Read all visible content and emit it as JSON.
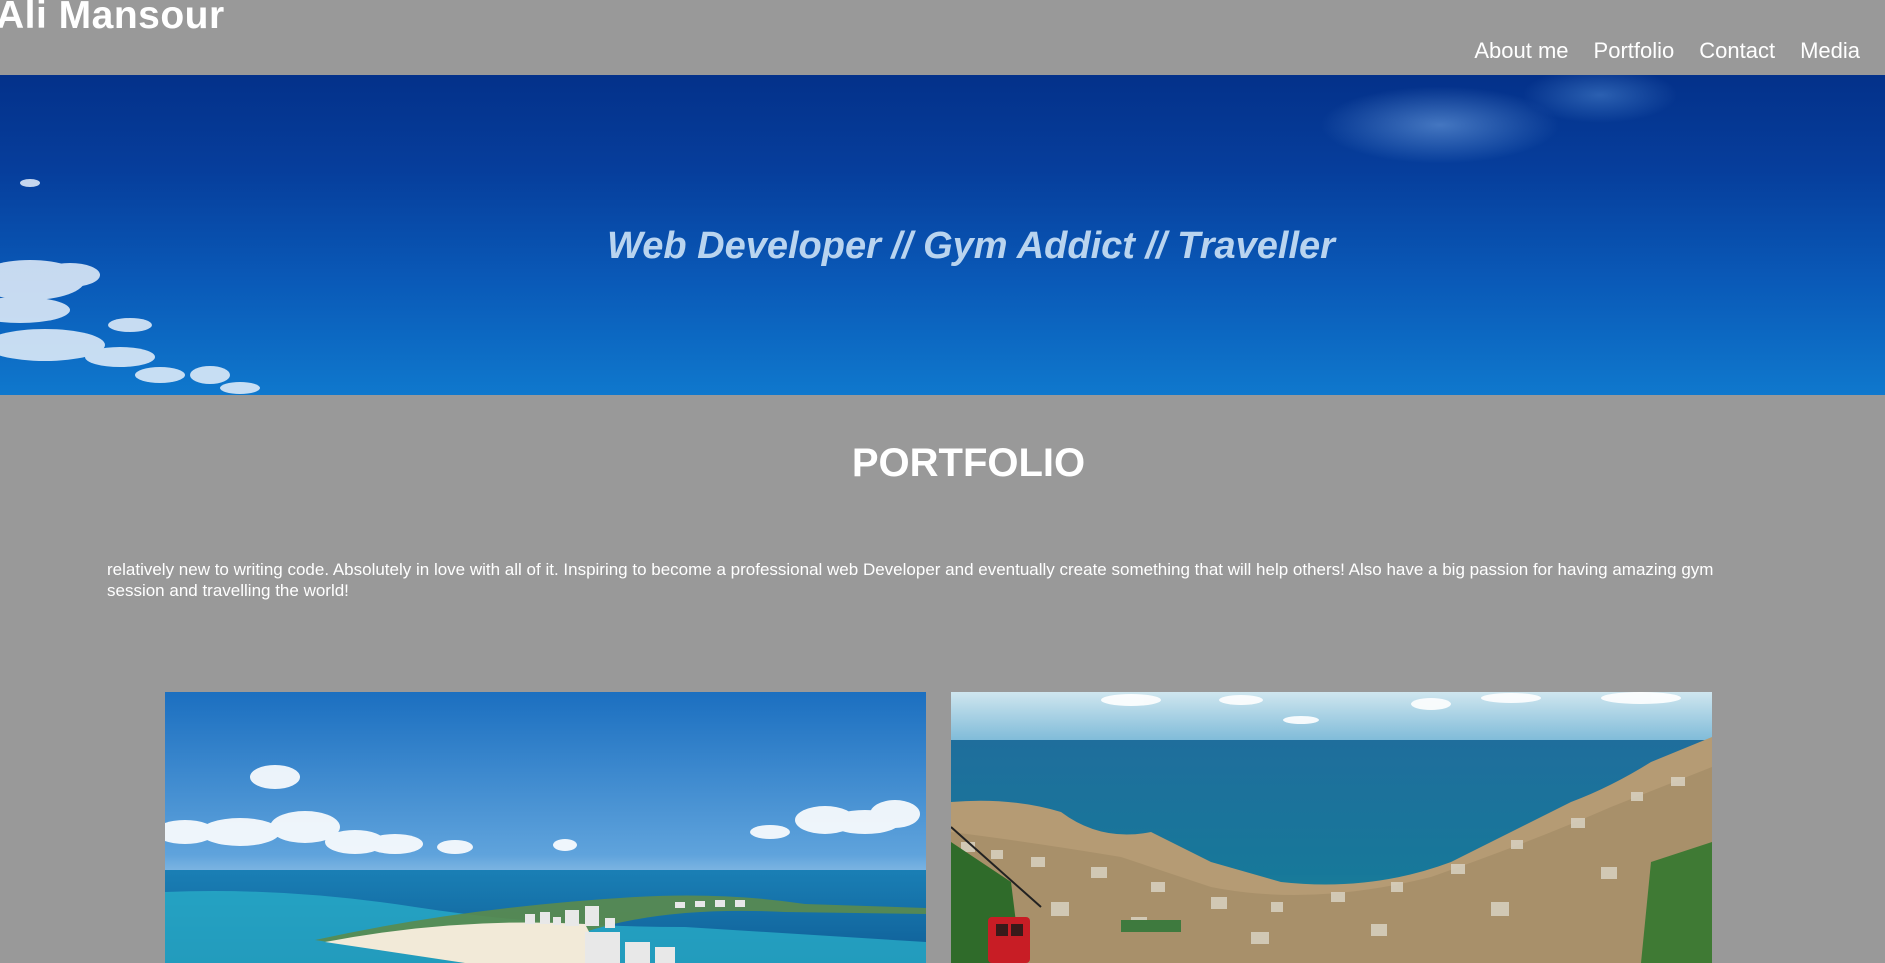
{
  "header": {
    "brand": "Ali Mansour",
    "nav": [
      "About me",
      "Portfolio",
      "Contact",
      "Media"
    ]
  },
  "hero": {
    "tagline": "Web Developer // Gym Addict // Traveller"
  },
  "portfolio": {
    "title": "PORTFOLIO",
    "intro": "relatively new to writing code. Absolutely in love with all of it. Inspiring to become a professional web Developer and eventually create something that will help others! Also have a big passion for having amazing gym session and travelling the world!"
  },
  "colors": {
    "page_background": "#999999",
    "text": "#ffffff",
    "hero_sky": "#0a5ab8",
    "tagline": "#b9d4ef"
  }
}
